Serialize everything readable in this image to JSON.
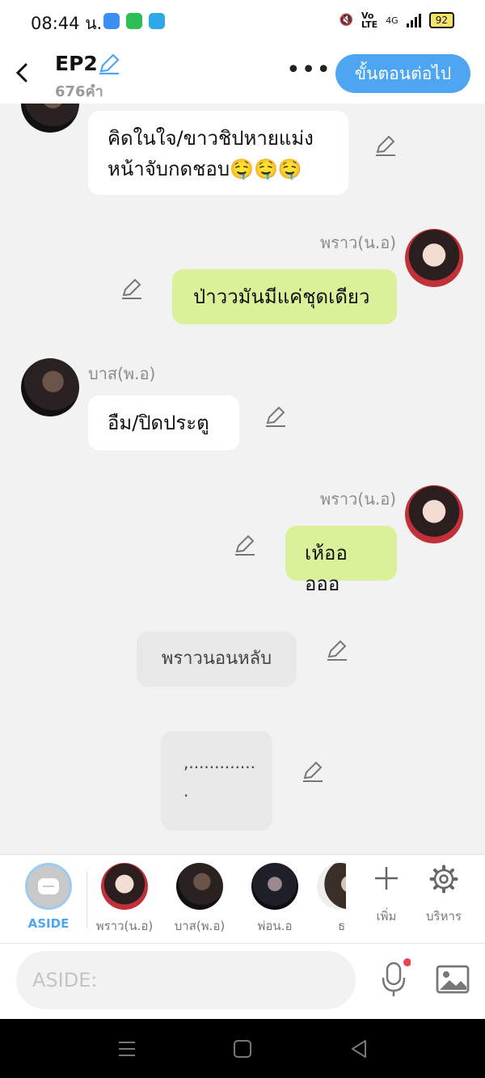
{
  "status_bar": {
    "time": "08:44 น.",
    "battery": "92",
    "network": "4G"
  },
  "header": {
    "title": "EP2",
    "word_count": "676คำ",
    "next_label": "ขั้นตอนต่อไป",
    "more_label": "•••"
  },
  "messages": [
    {
      "speaker": "",
      "text_line1": "คิดในใจ/ขาวชิปหายแม่ง",
      "text_line2": "หน้าจับกดชอบ🤤🤤🤤"
    },
    {
      "speaker": "พราว(น.อ)",
      "text": "ป่าววมันมีแค่ชุดเดียว"
    },
    {
      "speaker": "บาส(พ.อ)",
      "text": "อืม/ปิดประตู"
    },
    {
      "speaker": "พราว(น.อ)",
      "text": "เห้อออออ"
    },
    {
      "speaker": "",
      "text": "พราวนอนหลับ"
    },
    {
      "speaker": "",
      "text_line1": ",.............",
      "text_line2": "."
    }
  ],
  "characters": [
    {
      "label": "ASIDE"
    },
    {
      "label": "พราว(น.อ)"
    },
    {
      "label": "บาส(พ.อ)"
    },
    {
      "label": "พ่อน.อ"
    },
    {
      "label": "ธ"
    }
  ],
  "tools": {
    "add_label": "เพิ่ม",
    "manage_label": "บริหาร"
  },
  "input": {
    "placeholder": "ASIDE:"
  },
  "colors": {
    "accent": "#4ea6f3",
    "green_bubble": "#daf19a",
    "white_bubble": "#ffffff",
    "gray_bubble": "#e8e8e8"
  }
}
